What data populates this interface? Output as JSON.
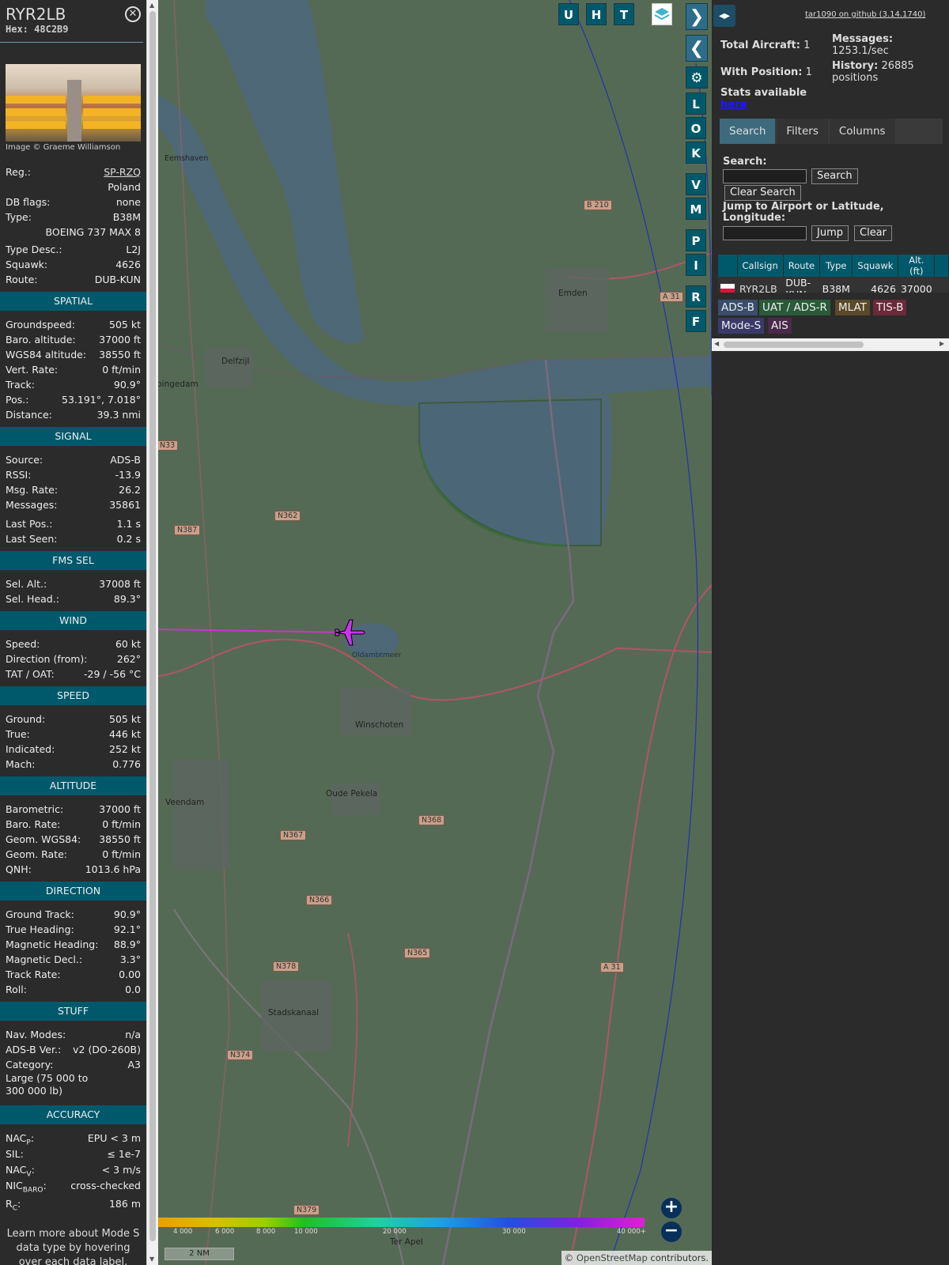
{
  "aircraft": {
    "callsign": "RYR2LB",
    "hex_label": "Hex:",
    "hex": "48C2B9",
    "photo_credit": "Image © Graeme Williamson",
    "reg_label": "Reg.:",
    "reg": "SP-RZQ",
    "country": "Poland",
    "dbflags_label": "DB flags:",
    "dbflags": "none",
    "type_label": "Type:",
    "type": "B38M",
    "type_full": "BOEING 737 MAX 8",
    "typedesc_label": "Type Desc.:",
    "typedesc": "L2J",
    "squawk_label": "Squawk:",
    "squawk": "4626",
    "route_label": "Route:",
    "route": "DUB-KUN"
  },
  "spatial": {
    "title": "SPATIAL",
    "rows": [
      {
        "k": "Groundspeed:",
        "v": "505 kt"
      },
      {
        "k": "Baro. altitude:",
        "v": "37000 ft"
      },
      {
        "k": "WGS84 altitude:",
        "v": "38550 ft"
      },
      {
        "k": "Vert. Rate:",
        "v": "0 ft/min"
      },
      {
        "k": "Track:",
        "v": "90.9°"
      },
      {
        "k": "Pos.:",
        "v": "53.191°, 7.018°"
      },
      {
        "k": "Distance:",
        "v": "39.3 nmi"
      }
    ]
  },
  "signal": {
    "title": "SIGNAL",
    "rows": [
      {
        "k": "Source:",
        "v": "ADS-B"
      },
      {
        "k": "RSSI:",
        "v": "-13.9"
      },
      {
        "k": "Msg. Rate:",
        "v": "26.2"
      },
      {
        "k": "Messages:",
        "v": "35861"
      }
    ],
    "rows2": [
      {
        "k": "Last Pos.:",
        "v": "1.1 s"
      },
      {
        "k": "Last Seen:",
        "v": "0.2 s"
      }
    ]
  },
  "fms": {
    "title": "FMS SEL",
    "rows": [
      {
        "k": "Sel. Alt.:",
        "v": "37008 ft"
      },
      {
        "k": "Sel. Head.:",
        "v": "89.3°"
      }
    ]
  },
  "wind": {
    "title": "WIND",
    "rows": [
      {
        "k": "Speed:",
        "v": "60 kt"
      },
      {
        "k": "Direction (from):",
        "v": "262°"
      },
      {
        "k": "TAT / OAT:",
        "v": "-29 / -56 °C"
      }
    ]
  },
  "speed": {
    "title": "SPEED",
    "rows": [
      {
        "k": "Ground:",
        "v": "505 kt"
      },
      {
        "k": "True:",
        "v": "446 kt"
      },
      {
        "k": "Indicated:",
        "v": "252 kt"
      },
      {
        "k": "Mach:",
        "v": "0.776"
      }
    ]
  },
  "altitude": {
    "title": "ALTITUDE",
    "rows": [
      {
        "k": "Barometric:",
        "v": "37000 ft"
      },
      {
        "k": "Baro. Rate:",
        "v": "0 ft/min"
      },
      {
        "k": "Geom. WGS84:",
        "v": "38550 ft"
      },
      {
        "k": "Geom. Rate:",
        "v": "0 ft/min"
      },
      {
        "k": "QNH:",
        "v": "1013.6 hPa"
      }
    ]
  },
  "direction": {
    "title": "DIRECTION",
    "rows": [
      {
        "k": "Ground Track:",
        "v": "90.9°"
      },
      {
        "k": "True Heading:",
        "v": "92.1°"
      },
      {
        "k": "Magnetic Heading:",
        "v": "88.9°"
      },
      {
        "k": "Magnetic Decl.:",
        "v": "3.3°"
      },
      {
        "k": "Track Rate:",
        "v": "0.00"
      },
      {
        "k": "Roll:",
        "v": "0.0"
      }
    ]
  },
  "stuff": {
    "title": "STUFF",
    "rows": [
      {
        "k": "Nav. Modes:",
        "v": "n/a"
      },
      {
        "k": "ADS-B Ver.:",
        "v": "v2 (DO-260B)"
      },
      {
        "k": "Category:",
        "v": "A3"
      }
    ],
    "category_desc": "Large (75 000 to 300 000 lb)"
  },
  "accuracy": {
    "title": "ACCURACY",
    "nacp_label": "NAC",
    "nacp_sub": "P",
    "nacp": "EPU < 3 m",
    "sil_label": "SIL:",
    "sil": "≤ 1e-7",
    "nacv_label": "NAC",
    "nacv_sub": "V",
    "nacv": "< 3 m/s",
    "nicbaro_label": "NIC",
    "nicbaro_sub": "BARO",
    "nicbaro": "cross-checked",
    "rc_label": "R",
    "rc_sub": "C",
    "rc": "186 m"
  },
  "learn_more": "Learn more about Mode S data type by hovering over each data label.",
  "map": {
    "buttons_top": [
      "U",
      "H",
      "T"
    ],
    "buttons_side": [
      "L",
      "O",
      "K",
      "V",
      "M",
      "P",
      "I",
      "R",
      "F"
    ],
    "places": [
      {
        "name": "Emden"
      },
      {
        "name": "Delfzijl"
      },
      {
        "name": "Winschoten"
      },
      {
        "name": "Oude Pekela"
      },
      {
        "name": "Veendam"
      },
      {
        "name": "Stadskanaal"
      },
      {
        "name": "Ter Apel"
      },
      {
        "name": "Eemshaven"
      },
      {
        "name": "Oldambtmeer"
      },
      {
        "name": "pingedam"
      }
    ],
    "roads": [
      "B 210",
      "A 31",
      "N33",
      "N362",
      "N387",
      "N368",
      "N367",
      "N366",
      "N378",
      "N365",
      "N374",
      "N379",
      "A 31"
    ],
    "altitude_scale": [
      "4 000",
      "6 000",
      "8 000",
      "10 000",
      "20 000",
      "30 000",
      "40 000+"
    ],
    "scale_label": "2 NM",
    "attribution_prefix": "© ",
    "attribution_link": "OpenStreetMap",
    "attribution_suffix": " contributors."
  },
  "sidebar": {
    "github_link": "tar1090 on github (3.14.1740)",
    "total_label": "Total Aircraft:",
    "total": "1",
    "position_label": "With Position:",
    "position": "1",
    "messages_label": "Messages:",
    "messages": "1253.1/sec",
    "history_label": "History:",
    "history": "26885 positions",
    "stats_label": "Stats available",
    "stats_link": "here",
    "tabs": [
      "Search",
      "Filters",
      "Columns"
    ],
    "search_label": "Search:",
    "search_button": "Search",
    "clear_search": "Clear Search",
    "jump_label": "Jump to Airport or Latitude, Longitude:",
    "jump_button": "Jump",
    "clear_button": "Clear",
    "table_headers": [
      "Callsign",
      "Route",
      "Type",
      "Squawk",
      "Alt. (ft)"
    ],
    "table_row": {
      "callsign": "RYR2LB",
      "route": "DUB-KUN",
      "type": "B38M",
      "squawk": "4626",
      "alt": "37000"
    },
    "chips": [
      "ADS-B",
      "UAT / ADS-R",
      "MLAT",
      "TIS-B",
      "Mode-S",
      "AIS"
    ]
  }
}
